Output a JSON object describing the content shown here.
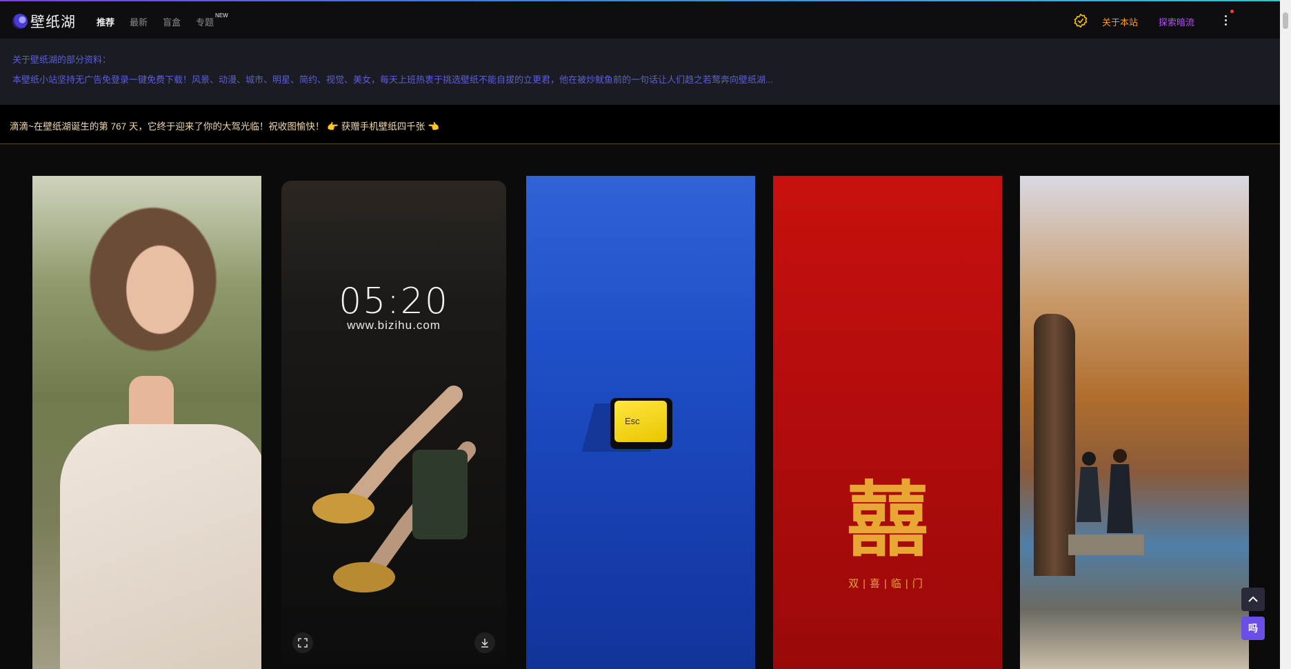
{
  "header": {
    "logo_text": "壁纸湖",
    "nav": [
      {
        "label": "推荐"
      },
      {
        "label": "最新"
      },
      {
        "label": "盲盒"
      },
      {
        "label": "专题",
        "badge": "NEW"
      }
    ],
    "about_label": "关于本站",
    "explore_label": "探索暗流"
  },
  "info": {
    "title": "关于壁纸湖的部分资料：",
    "description": "本壁纸小站坚持无广告免登录一键免费下载！风景、动漫、城市、明星、简约、视觉、美女，每天上班热衷于挑选壁纸不能自拔的立更君，他在被炒鱿鱼前的一句话让人们趋之若鹜奔向壁纸湖..."
  },
  "notice": {
    "text": "滴滴~在壁纸湖诞生的第 767 天，它终于迎来了你的大驾光临！祝收图愉快！ 👉 获赠手机壁纸四千张 👈"
  },
  "wallpapers": {
    "clock_time": "05:20",
    "clock_site": "www.bizihu.com",
    "esc_label": "Esc",
    "xi_char": "囍",
    "xi_subtitle": "双|喜|临|门"
  },
  "floating": {
    "chat_label": "吗"
  },
  "colors": {
    "accent_cyan": "#23d0e0",
    "about_orange": "#ff9a1f",
    "explore_purple": "#b54cff",
    "info_text": "#5b5fd6",
    "notice_text": "#f2d9a8"
  }
}
